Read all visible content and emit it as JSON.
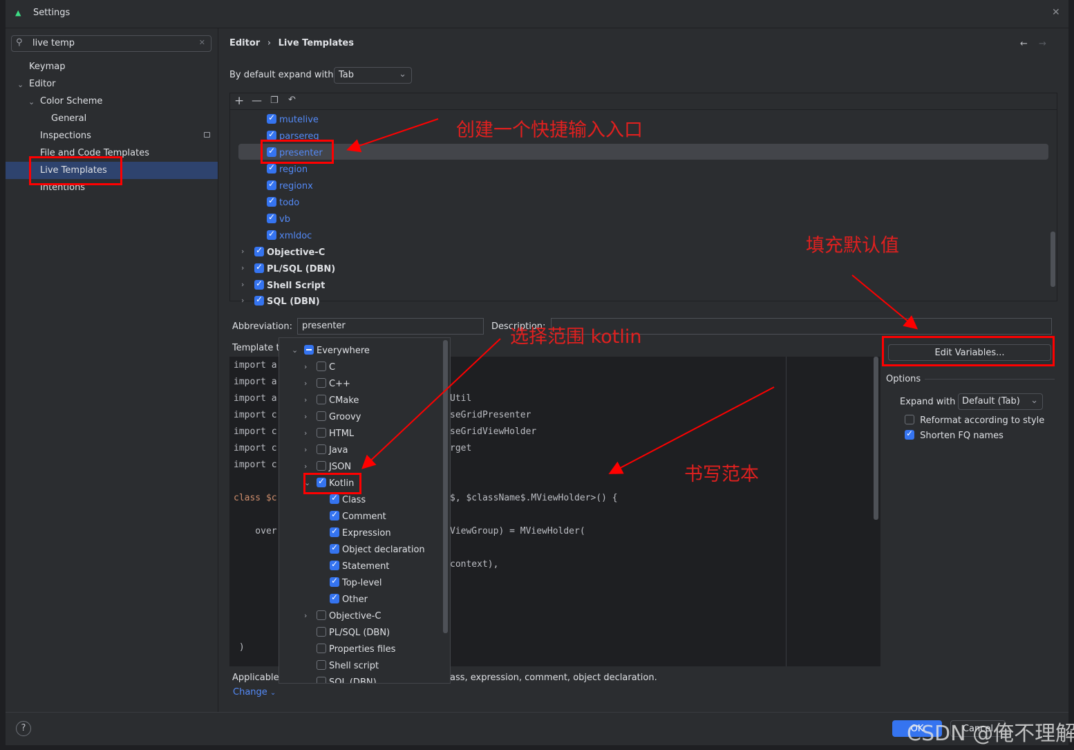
{
  "window": {
    "title": "Settings"
  },
  "search": {
    "value": "live temp"
  },
  "sidebar": {
    "items": [
      {
        "label": "Keymap"
      },
      {
        "label": "Editor"
      },
      {
        "label": "Color Scheme"
      },
      {
        "label": "General"
      },
      {
        "label": "Inspections"
      },
      {
        "label": "File and Code Templates"
      },
      {
        "label": "Live Templates",
        "selected": true
      },
      {
        "label": "Intentions"
      }
    ]
  },
  "breadcrumb": {
    "parent": "Editor",
    "current": "Live Templates"
  },
  "expand": {
    "label": "By default expand with",
    "value": "Tab"
  },
  "templates": {
    "items": [
      {
        "label": "mutelive",
        "checked": true
      },
      {
        "label": "parsereq",
        "checked": true
      },
      {
        "label": "presenter",
        "checked": true,
        "selected": true
      },
      {
        "label": "region",
        "checked": true
      },
      {
        "label": "regionx",
        "checked": true
      },
      {
        "label": "todo",
        "checked": true
      },
      {
        "label": "vb",
        "checked": true
      },
      {
        "label": "xmldoc",
        "checked": true
      }
    ],
    "groups": [
      {
        "label": "Objective-C"
      },
      {
        "label": "PL/SQL (DBN)"
      },
      {
        "label": "Shell Script"
      },
      {
        "label": "SQL (DBN)"
      }
    ]
  },
  "abbreviation": {
    "label": "Abbreviation:",
    "value": "presenter"
  },
  "description": {
    "label": "Description:",
    "value": ""
  },
  "template_text_label": "Template t",
  "code": {
    "left": [
      "import a",
      "import a",
      "import a",
      "import c",
      "import c",
      "import c",
      "import c",
      "",
      "class $c",
      "",
      "    over",
      "",
      "",
      "",
      "",
      "",
      "",
      " )"
    ],
    "right": [
      "",
      "",
      "Util",
      "seGridPresenter",
      "seGridViewHolder",
      "rget",
      "",
      "",
      "$, $className$.MViewHolder>() {",
      "",
      "ViewGroup) = MViewHolder(",
      "",
      "context),",
      "",
      "",
      "",
      "",
      ""
    ]
  },
  "context_popup": {
    "items": [
      {
        "label": "Everywhere",
        "state": "partial",
        "level": 0,
        "expander": "open"
      },
      {
        "label": "C",
        "state": "off",
        "level": 1,
        "expander": "closed"
      },
      {
        "label": "C++",
        "state": "off",
        "level": 1,
        "expander": "closed"
      },
      {
        "label": "CMake",
        "state": "off",
        "level": 1,
        "expander": "closed"
      },
      {
        "label": "Groovy",
        "state": "off",
        "level": 1,
        "expander": "closed"
      },
      {
        "label": "HTML",
        "state": "off",
        "level": 1,
        "expander": "closed"
      },
      {
        "label": "Java",
        "state": "off",
        "level": 1,
        "expander": "closed"
      },
      {
        "label": "JSON",
        "state": "off",
        "level": 1,
        "expander": "closed"
      },
      {
        "label": "Kotlin",
        "state": "on",
        "level": 1,
        "expander": "open"
      },
      {
        "label": "Class",
        "state": "on",
        "level": 2
      },
      {
        "label": "Comment",
        "state": "on",
        "level": 2
      },
      {
        "label": "Expression",
        "state": "on",
        "level": 2
      },
      {
        "label": "Object declaration",
        "state": "on",
        "level": 2
      },
      {
        "label": "Statement",
        "state": "on",
        "level": 2
      },
      {
        "label": "Top-level",
        "state": "on",
        "level": 2
      },
      {
        "label": "Other",
        "state": "on",
        "level": 2
      },
      {
        "label": "Objective-C",
        "state": "off",
        "level": 1,
        "expander": "closed"
      },
      {
        "label": "PL/SQL (DBN)",
        "state": "off",
        "level": 1
      },
      {
        "label": "Properties files",
        "state": "off",
        "level": 1
      },
      {
        "label": "Shell script",
        "state": "off",
        "level": 1
      },
      {
        "label": "SQL (DBN)",
        "state": "off",
        "level": 1
      }
    ]
  },
  "applicable": {
    "prefix": "Applicable",
    "suffix": "ass, expression, comment, object declaration.",
    "change": "Change"
  },
  "edit_variables": "Edit Variables...",
  "options": {
    "title": "Options",
    "expand_label": "Expand with",
    "expand_value": "Default (Tab)",
    "reformat": {
      "label": "Reformat according to style",
      "checked": false
    },
    "shorten": {
      "label": "Shorten FQ names",
      "checked": true
    }
  },
  "footer": {
    "ok": "OK",
    "cancel": "Cancel",
    "help": "?"
  },
  "annotations": {
    "create": "创建一个快捷输入入口",
    "fill": "填充默认值",
    "scope": "选择范围 kotlin",
    "write": "书写范本"
  },
  "watermark": "CSDN @俺不理解",
  "colors": {
    "accent": "#3574f0",
    "annotation": "#ff0000",
    "link": "#548af7"
  }
}
